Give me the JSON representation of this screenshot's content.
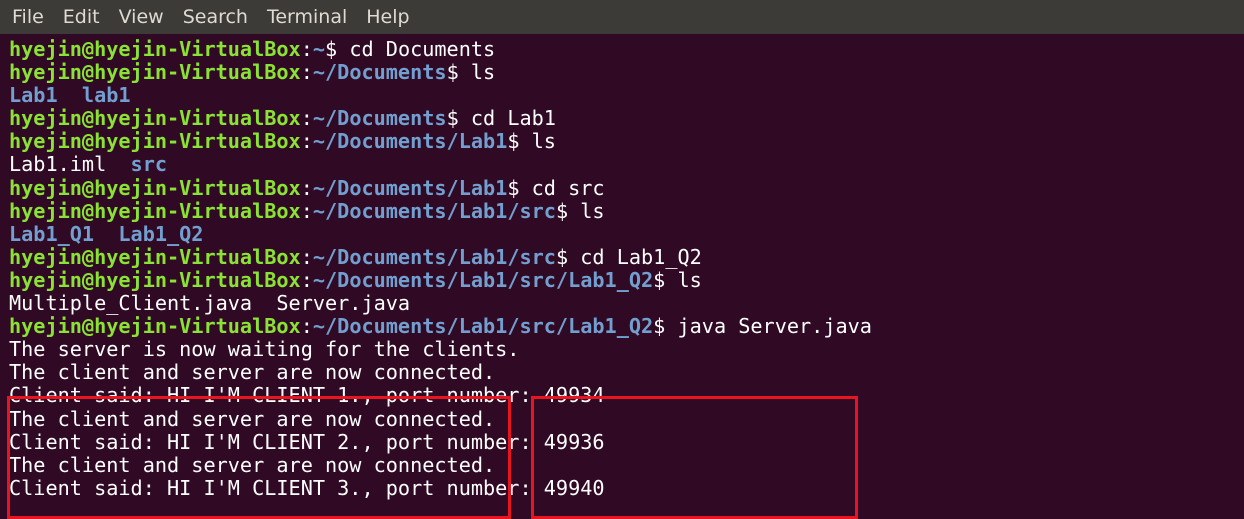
{
  "menu": [
    "File",
    "Edit",
    "View",
    "Search",
    "Terminal",
    "Help"
  ],
  "colors": {
    "background": "#300a24",
    "menubar": "#3c3b37",
    "user_host": "#8ae234",
    "path": "#729fcf",
    "text": "#ffffff",
    "highlight_box": "#e8141f"
  },
  "terminal": {
    "lines": [
      {
        "user": "hyejin@hyejin-VirtualBox",
        "sep": ":",
        "path": "~",
        "prompt": "$ ",
        "cmd": "cd Documents"
      },
      {
        "user": "hyejin@hyejin-VirtualBox",
        "sep": ":",
        "path": "~/Documents",
        "prompt": "$ ",
        "cmd": "ls"
      },
      {
        "dirs": "Lab1  lab1"
      },
      {
        "user": "hyejin@hyejin-VirtualBox",
        "sep": ":",
        "path": "~/Documents",
        "prompt": "$ ",
        "cmd": "cd Lab1"
      },
      {
        "user": "hyejin@hyejin-VirtualBox",
        "sep": ":",
        "path": "~/Documents/Lab1",
        "prompt": "$ ",
        "cmd": "ls"
      },
      {
        "file": "Lab1.iml  ",
        "dir": "src"
      },
      {
        "user": "hyejin@hyejin-VirtualBox",
        "sep": ":",
        "path": "~/Documents/Lab1",
        "prompt": "$ ",
        "cmd": "cd src"
      },
      {
        "user": "hyejin@hyejin-VirtualBox",
        "sep": ":",
        "path": "~/Documents/Lab1/src",
        "prompt": "$ ",
        "cmd": "ls"
      },
      {
        "dirs": "Lab1_Q1  Lab1_Q2"
      },
      {
        "user": "hyejin@hyejin-VirtualBox",
        "sep": ":",
        "path": "~/Documents/Lab1/src",
        "prompt": "$ ",
        "cmd": "cd Lab1_Q2"
      },
      {
        "user": "hyejin@hyejin-VirtualBox",
        "sep": ":",
        "path": "~/Documents/Lab1/src/Lab1_Q2",
        "prompt": "$ ",
        "cmd": "ls"
      },
      {
        "text": "Multiple_Client.java  Server.java"
      },
      {
        "user": "hyejin@hyejin-VirtualBox",
        "sep": ":",
        "path": "~/Documents/Lab1/src/Lab1_Q2",
        "prompt": "$ ",
        "cmd": "java Server.java"
      },
      {
        "text": "The server is now waiting for the clients."
      },
      {
        "text": "The client and server are now connected."
      },
      {
        "text": "Client said: HI I'M CLIENT 1., port number: 49934"
      },
      {
        "text": "The client and server are now connected."
      },
      {
        "text": "Client said: HI I'M CLIENT 2., port number: 49936"
      },
      {
        "text": "The client and server are now connected."
      },
      {
        "text": "Client said: HI I'M CLIENT 3., port number: 49940"
      }
    ]
  }
}
